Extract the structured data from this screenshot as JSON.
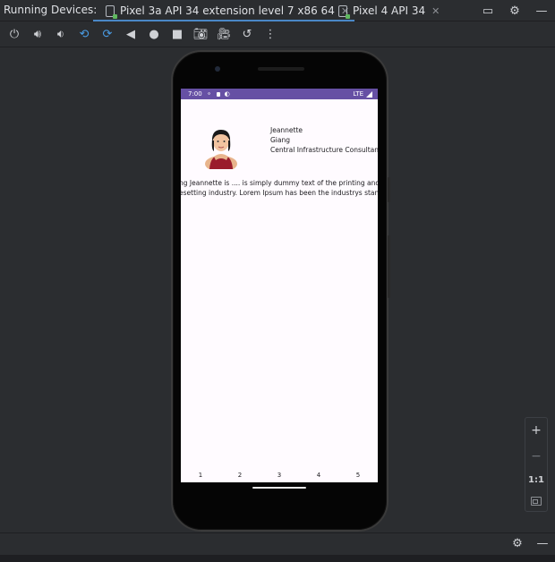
{
  "tabbar": {
    "title": "Running Devices:",
    "tabs": [
      {
        "label": "Pixel 3a API 34 extension level 7 x86 64",
        "close": "✕",
        "active": true
      },
      {
        "label": "Pixel 4 API 34",
        "close": "✕",
        "active": false
      }
    ],
    "right_icons": [
      "maximize-icon",
      "gear-icon",
      "minimize-icon"
    ]
  },
  "toolbar": {
    "icons": [
      "power-icon",
      "volume-up-icon",
      "volume-down-icon",
      "rotate-left-icon",
      "rotate-right-icon",
      "back-icon",
      "home-icon",
      "overview-icon",
      "screenshot-icon",
      "screen-record-icon",
      "snapshot-icon",
      "more-icon"
    ],
    "accent": "#4a9de6"
  },
  "device": {
    "statusbar": {
      "time": "7:00",
      "network": "LTE",
      "color": "#6650a4"
    },
    "profile": {
      "first_name": "Jeannette",
      "last_name": "Giang",
      "title": "Central Infrastructure Consultant"
    },
    "description": {
      "line1": "ng Jeannette is .... is simply dummy text of the printing and",
      "line2": "esetting industry. Lorem Ipsum has been the industrys standar"
    },
    "bottom_numbers": [
      "1",
      "2",
      "3",
      "4",
      "5"
    ]
  },
  "zoom_panel": {
    "zoom_in": "+",
    "zoom_out": "−",
    "actual_size": "1:1"
  }
}
